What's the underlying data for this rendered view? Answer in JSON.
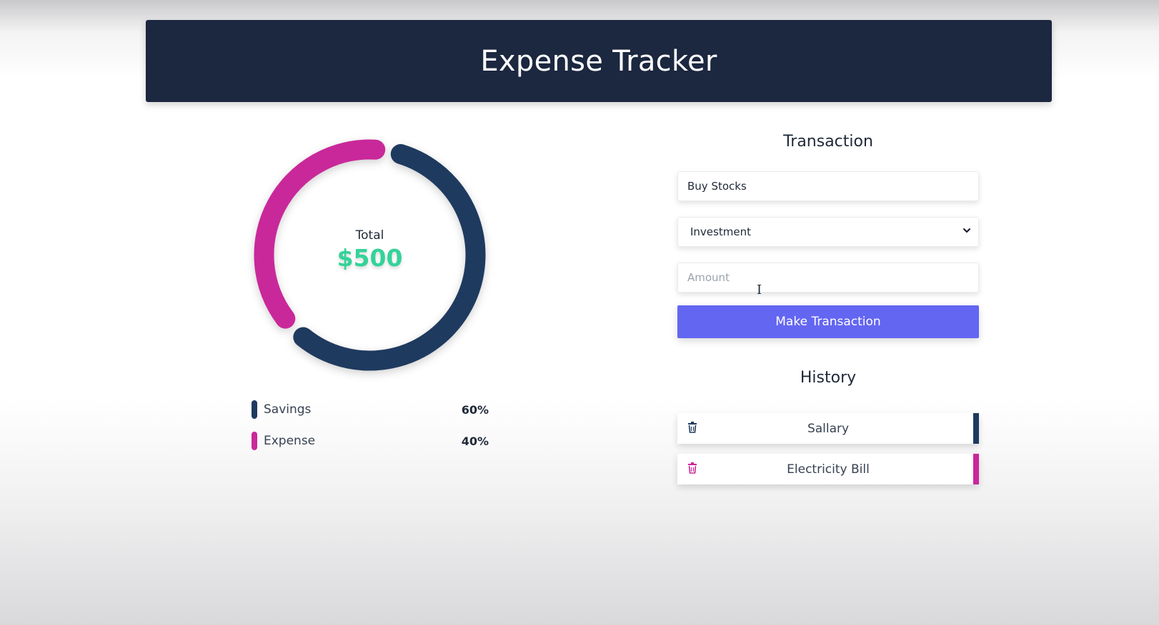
{
  "app": {
    "title": "Expense Tracker"
  },
  "summary": {
    "total_label": "Total",
    "total_value": "$500"
  },
  "chart_data": {
    "type": "pie",
    "categories": [
      "Savings",
      "Expense"
    ],
    "values": [
      60,
      40
    ],
    "colors": [
      "#1f3a5f",
      "#c9289a"
    ],
    "legend_placement": "bottom"
  },
  "legend": [
    {
      "label": "Savings",
      "value": "60%",
      "color": "#1f3a5f"
    },
    {
      "label": "Expense",
      "value": "40%",
      "color": "#c9289a"
    }
  ],
  "transaction": {
    "title": "Transaction",
    "name_value": "Buy Stocks",
    "category_value": "Investment",
    "amount_placeholder": "Amount",
    "submit_label": "Make Transaction"
  },
  "history": {
    "title": "History",
    "items": [
      {
        "name": "Sallary",
        "color": "#1f3a5f",
        "icon": "trash-icon"
      },
      {
        "name": "Electricity Bill",
        "color": "#c9289a",
        "icon": "trash-icon"
      }
    ]
  },
  "colors": {
    "header_bg": "#1c2740",
    "accent_button": "#6366f1",
    "total_green": "#34d399"
  }
}
